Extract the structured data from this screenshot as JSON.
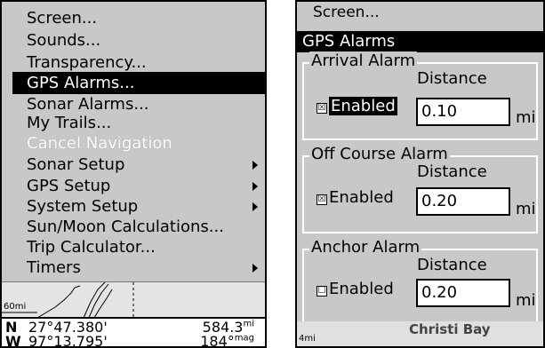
{
  "left_menu": {
    "items": [
      {
        "label": "Screen...",
        "selected": false,
        "disabled": false,
        "submenu": false
      },
      {
        "label": "Sounds...",
        "selected": false,
        "disabled": false,
        "submenu": false
      },
      {
        "label": "Transparency...",
        "selected": false,
        "disabled": false,
        "submenu": false
      },
      {
        "label": "GPS Alarms...",
        "selected": true,
        "disabled": false,
        "submenu": false
      },
      {
        "label": "Sonar Alarms...",
        "selected": false,
        "disabled": false,
        "submenu": false
      },
      {
        "label": "My Trails...",
        "selected": false,
        "disabled": false,
        "submenu": false
      },
      {
        "label": "Cancel Navigation",
        "selected": false,
        "disabled": true,
        "submenu": false
      },
      {
        "label": "Sonar Setup",
        "selected": false,
        "disabled": false,
        "submenu": true
      },
      {
        "label": "GPS Setup",
        "selected": false,
        "disabled": false,
        "submenu": true
      },
      {
        "label": "System Setup",
        "selected": false,
        "disabled": false,
        "submenu": true
      },
      {
        "label": "Sun/Moon Calculations...",
        "selected": false,
        "disabled": false,
        "submenu": false
      },
      {
        "label": "Trip Calculator...",
        "selected": false,
        "disabled": false,
        "submenu": false
      },
      {
        "label": "Timers",
        "selected": false,
        "disabled": false,
        "submenu": true
      }
    ]
  },
  "left_map": {
    "scale": "60mi"
  },
  "left_coords": {
    "lat_dir": "N",
    "lat": "27°47.380'",
    "lon_dir": "W",
    "lon": "97°13.795'",
    "distance": "584.3",
    "distance_unit": "mi",
    "heading": "184°",
    "heading_unit": "mag"
  },
  "right_panel": {
    "menu_item": "Screen...",
    "title": "GPS Alarms",
    "groups": [
      {
        "title": "Arrival Alarm",
        "distance_label": "Distance",
        "checkbox": "☒",
        "enabled_label": "Enabled",
        "enabled_selected": true,
        "value": "0.10",
        "unit": "mi"
      },
      {
        "title": "Off Course Alarm",
        "distance_label": "Distance",
        "checkbox": "☒",
        "enabled_label": "Enabled",
        "enabled_selected": false,
        "value": "0.20",
        "unit": "mi"
      },
      {
        "title": "Anchor Alarm",
        "distance_label": "Distance",
        "checkbox": "☐",
        "enabled_label": "Enabled",
        "enabled_selected": false,
        "value": "0.20",
        "unit": "mi"
      }
    ],
    "footer_scale": "4mi",
    "footer_place": "Christi Bay"
  }
}
